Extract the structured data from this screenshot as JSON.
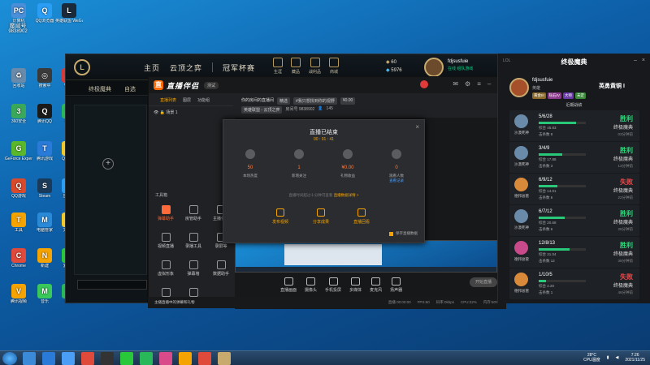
{
  "desktop": {
    "icons": [
      {
        "label": "计算机",
        "color": "#4a8fd8",
        "glyph": "PC"
      },
      {
        "label": "QQ浏览器",
        "color": "#2a9ef5",
        "glyph": "Q"
      },
      {
        "label": "英雄联盟 WeGame版",
        "color": "#1a2a3a",
        "glyph": "L"
      },
      {
        "label": "回收站",
        "color": "#6a8aaa",
        "glyph": "♻"
      },
      {
        "label": "搜索中",
        "color": "#3a3a3a",
        "glyph": "◎"
      },
      {
        "label": "WPS",
        "color": "#d83a3a",
        "glyph": "W"
      },
      {
        "label": "360安全",
        "color": "#3aa85a",
        "glyph": "3"
      },
      {
        "label": "腾讯QQ",
        "color": "#1a1a1a",
        "glyph": "Q"
      },
      {
        "label": "微信",
        "color": "#28b85a",
        "glyph": "W"
      },
      {
        "label": "GeForce Experience",
        "color": "#5ab82a",
        "glyph": "G"
      },
      {
        "label": "腾讯游戏",
        "color": "#2a7ad8",
        "glyph": "T"
      },
      {
        "label": "QQ音乐",
        "color": "#f5c82a",
        "glyph": "♪"
      },
      {
        "label": "QQ游戏",
        "color": "#d84a2a",
        "glyph": "Q"
      },
      {
        "label": "Steam",
        "color": "#1a3a5a",
        "glyph": "S"
      },
      {
        "label": "应用宝",
        "color": "#2a9ef5",
        "glyph": "A"
      },
      {
        "label": "工具",
        "color": "#f5a300",
        "glyph": "T"
      },
      {
        "label": "电脑管家",
        "color": "#2a8ad8",
        "glyph": "M"
      },
      {
        "label": "文件夹",
        "color": "#f5c82a",
        "glyph": "F"
      },
      {
        "label": "Chrome",
        "color": "#e04a3a",
        "glyph": "C"
      },
      {
        "label": "新建",
        "color": "#f5a300",
        "glyph": "N"
      },
      {
        "label": "爱奇艺",
        "color": "#28c83a",
        "glyph": "i"
      },
      {
        "label": "腾讯视频",
        "color": "#f5a300",
        "glyph": "V"
      },
      {
        "label": "音乐",
        "color": "#3ac85a",
        "glyph": "M"
      },
      {
        "label": "微信",
        "color": "#28b85a",
        "glyph": "W"
      }
    ],
    "top_label": "魔闻号",
    "top_id": "9838902"
  },
  "lol": {
    "logo": "L",
    "nav": [
      "主页",
      "云顶之弈",
      "冠军杯赛"
    ],
    "top_icons": [
      "生涯",
      "藏品",
      "战利品",
      "商城"
    ],
    "currency": {
      "be": "60",
      "rp": "5976"
    },
    "username": "fdjsusfuie",
    "status": "在线 组队游戏",
    "sub_tabs": [
      "终极魔典",
      "自选"
    ]
  },
  "stream": {
    "title": "直播伴侣",
    "version": "测试",
    "tabs": [
      "直播列表",
      "图层",
      "功能组"
    ],
    "scene": "场景 1",
    "room_title": "你的房间的直播间",
    "tag1": "精选",
    "tag2": "#我只想找到你的视野",
    "tag3": "¥0.00",
    "category": "英雄联盟 - 云顶之弈",
    "room_id": "房间号 9838902",
    "viewers": "145",
    "tools_title": "工具箱",
    "tools": [
      {
        "label": "弹幕助手",
        "on": true
      },
      {
        "label": "房管助手",
        "on": false
      },
      {
        "label": "主播任务",
        "on": false
      },
      {
        "label": "视频直播",
        "on": false
      },
      {
        "label": "录播工具",
        "on": false
      },
      {
        "label": "录屏等",
        "on": false
      },
      {
        "label": "虚拟形象",
        "on": false
      },
      {
        "label": "弹幕墙",
        "on": false
      },
      {
        "label": "数据助手",
        "on": false
      },
      {
        "label": "PK",
        "on": false
      },
      {
        "label": "更多",
        "on": false
      }
    ],
    "bottom_tools": [
      "直播画面",
      "摄像头",
      "手机投屏",
      "多媒体",
      "麦克风",
      "扬声器"
    ],
    "go_live": "开始直播",
    "status_left": "主播直播中的弹幕和礼物",
    "status_right": [
      "直播 00:00:00",
      "FPS:60",
      "码率:0kbps",
      "CPU:22%",
      "内存:50%"
    ]
  },
  "modal": {
    "title": "直播已结束",
    "time": "00 : 01 : 41",
    "stats": [
      {
        "value": "50",
        "label": "本场热度",
        "link": ""
      },
      {
        "value": "1",
        "label": "新增关注",
        "link": ""
      },
      {
        "value": "¥0.00",
        "label": "礼物收益",
        "link": ""
      },
      {
        "value": "0",
        "label": "观看人数",
        "link": "查看记录"
      }
    ],
    "notice_a": "直播时间超过十分钟可查看",
    "notice_link": "直播数据详情 >",
    "actions": [
      "发布视频",
      "分享成果",
      "直播回看"
    ],
    "check": "保存直播数据"
  },
  "matches": {
    "title": "终极魔典",
    "logo": "LOL",
    "profile_name": "fdjsusfuie",
    "profile_sub": "英雄",
    "ranks": [
      "黄金III",
      "钻石IV",
      "大师",
      "未定"
    ],
    "mode_title": "英勇黄铜 I",
    "recent": "近期战绩",
    "list": [
      {
        "kda": "5/6/28",
        "champ": "沙漠死神",
        "score": "综合 45.83",
        "dmg": "击杀数 8",
        "result": "胜利",
        "mode": "终极魔典",
        "time": "03分钟前",
        "win": true,
        "hp": 0.8,
        "color": "#6a8aaa"
      },
      {
        "kda": "3/4/9",
        "champ": "沙漠死神",
        "score": "综合 17.88",
        "dmg": "击杀数 3",
        "result": "胜利",
        "mode": "终极魔典",
        "time": "13分钟前",
        "win": true,
        "hp": 0.5,
        "color": "#6a8aaa"
      },
      {
        "kda": "6/9/12",
        "champ": "德邦总管",
        "score": "综合 14.01",
        "dmg": "击杀数 6",
        "result": "失败",
        "mode": "终极魔典",
        "time": "22分钟前",
        "win": false,
        "hp": 0.4,
        "color": "#d88a3a"
      },
      {
        "kda": "6/7/12",
        "champ": "沙漠死神",
        "score": "综合 20.68",
        "dmg": "击杀数 6",
        "result": "胜利",
        "mode": "终极魔典",
        "time": "28分钟前",
        "win": true,
        "hp": 0.55,
        "color": "#6a8aaa"
      },
      {
        "kda": "12/8/13",
        "champ": "德邦总管",
        "score": "综合 31.04",
        "dmg": "击杀数 12",
        "result": "胜利",
        "mode": "终极魔典",
        "time": "39分钟前",
        "win": true,
        "hp": 0.65,
        "color": "#c84a8a"
      },
      {
        "kda": "1/10/5",
        "champ": "德邦总管",
        "score": "综合 2.20",
        "dmg": "击杀数 1",
        "result": "失败",
        "mode": "终极魔典",
        "time": "46分钟前",
        "win": false,
        "hp": 0.15,
        "color": "#d88a3a"
      }
    ]
  },
  "taskbar": {
    "apps": [
      "#3a8ad8",
      "#2a7ad8",
      "#4a9ef5",
      "#e04a3a",
      "#333",
      "#28c83a",
      "#28b85a",
      "#d84a8a",
      "#f5a300",
      "#e04a3a",
      "#c8aa6e"
    ],
    "weather": "28°C",
    "cpu": "CPU温度",
    "time": "7:26",
    "date": "2021/11/25"
  }
}
